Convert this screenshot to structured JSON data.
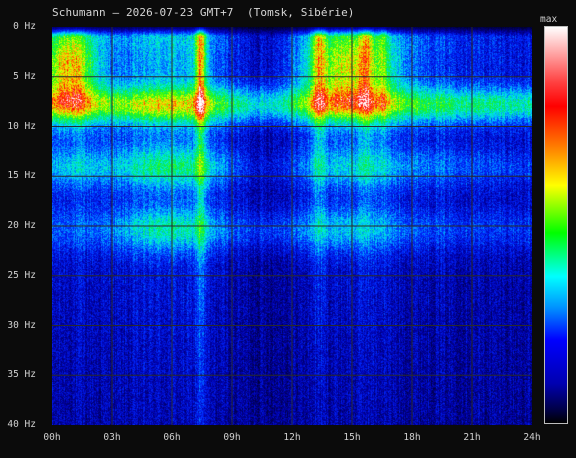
{
  "title": "Schumann – 2026-07-23 GMT+7  (Tomsk, Sibérie)",
  "colorbar": {
    "label": "max",
    "stops": [
      "#ffffff",
      "#ff0000",
      "#ff7a00",
      "#ffff00",
      "#00ff00",
      "#00ffff",
      "#0000ff",
      "#000040",
      "#000000"
    ]
  },
  "colors": {
    "background": "#0b0b0b",
    "grid": "#2a2a2a",
    "text": "#d0d0d0"
  },
  "chart_data": {
    "type": "heatmap",
    "title": "Schumann – 2026-07-23 GMT+7  (Tomsk, Sibérie)",
    "x_ticks": [
      "00h",
      "03h",
      "06h",
      "09h",
      "12h",
      "15h",
      "18h",
      "21h",
      "24h"
    ],
    "y_ticks": [
      "0 Hz",
      "5 Hz",
      "10 Hz",
      "15 Hz",
      "20 Hz",
      "25 Hz",
      "30 Hz",
      "35 Hz",
      "40 Hz"
    ],
    "xlim": [
      0,
      24
    ],
    "ylim": [
      0,
      40
    ],
    "x_unit": "h",
    "y_unit": "Hz",
    "grid": true,
    "harmonic_bands_hz": [
      7.8,
      14.1,
      20.3
    ],
    "high_intensity_periods_h": [
      [
        0,
        2.5
      ],
      [
        7,
        7.8
      ],
      [
        12.5,
        17.5
      ]
    ]
  }
}
